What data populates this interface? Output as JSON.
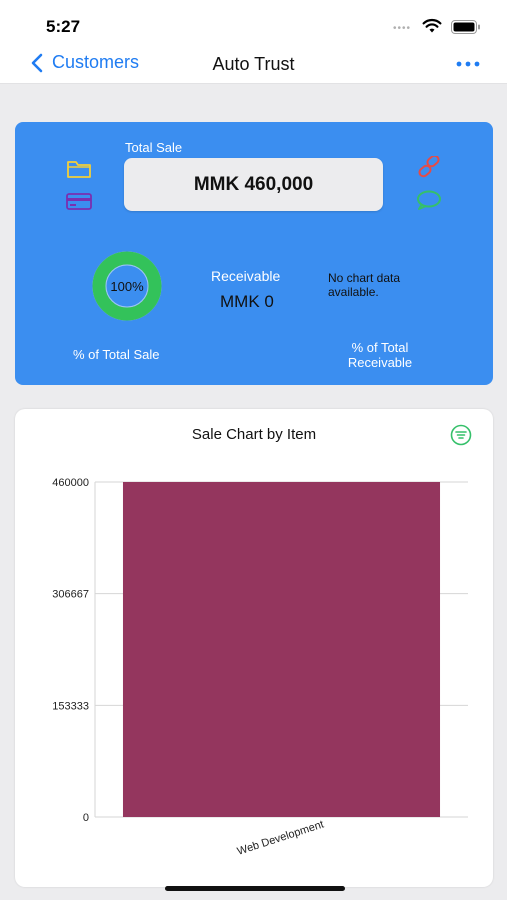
{
  "status_bar": {
    "time": "5:27"
  },
  "nav": {
    "back_label": "Customers",
    "title": "Auto Trust"
  },
  "summary": {
    "total_sale_label": "Total Sale",
    "total_sale_value": "MMK 460,000",
    "donut_label": "100%",
    "donut_fraction": 1.0,
    "receivable_label": "Receivable",
    "receivable_value": "MMK 0",
    "no_chart_data": "No chart data available.",
    "pct_total_sale_label": "% of Total Sale",
    "pct_total_receivable_label": "% of Total Receivable",
    "colors": {
      "card": "#3b8ef0",
      "donut": "#33c25a"
    },
    "icons": [
      "folder-icon",
      "credit-card-icon",
      "link-icon",
      "chat-bubble-icon"
    ]
  },
  "chart_data": {
    "type": "bar",
    "title": "Sale Chart by Item",
    "categories": [
      "Web Development"
    ],
    "values": [
      460000
    ],
    "ylim": [
      0,
      460000
    ],
    "yticks": [
      "460000",
      "306667",
      "153333",
      "0"
    ],
    "ytick_values": [
      460000,
      306667,
      153333,
      0
    ],
    "bar_color": "#94365e",
    "grid": true
  }
}
